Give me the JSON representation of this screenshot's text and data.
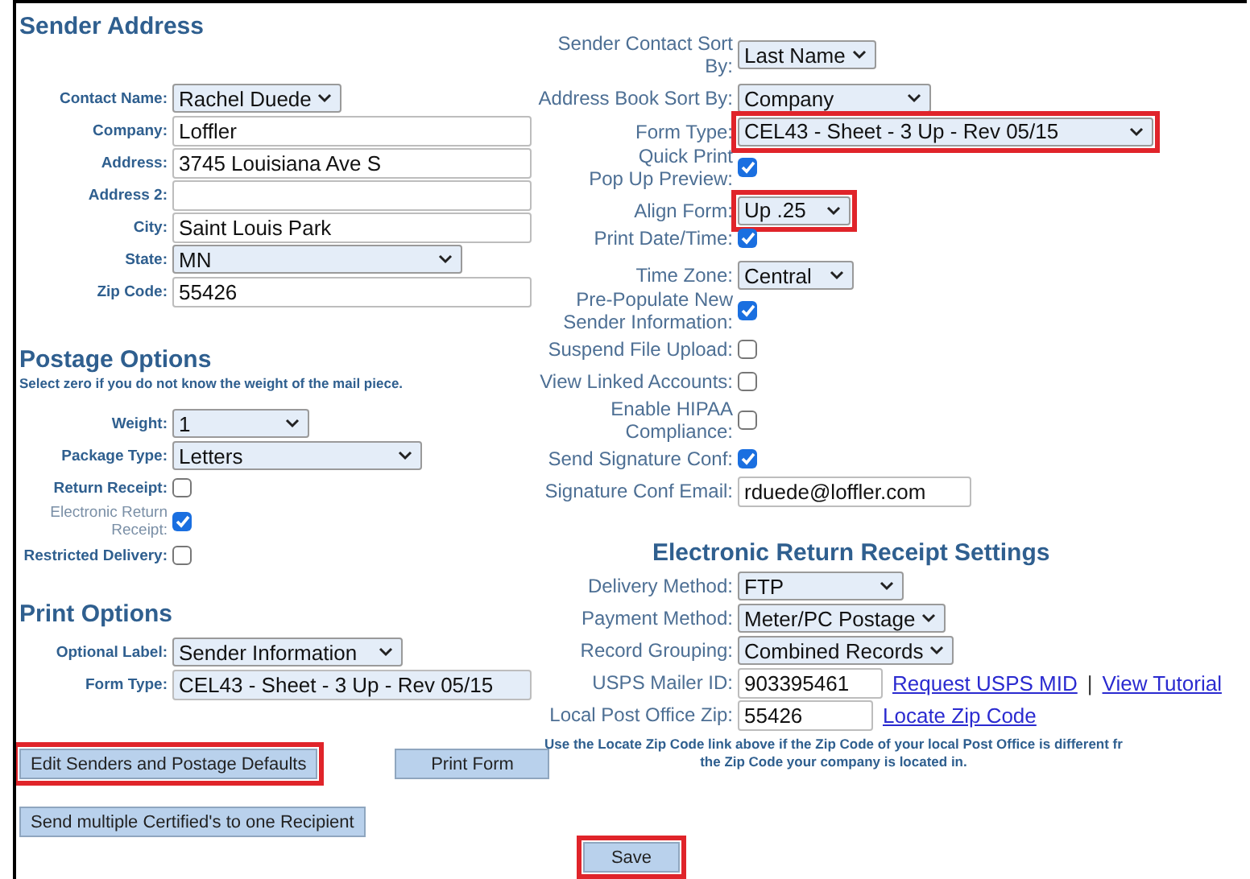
{
  "sender_address": {
    "title": "Sender Address",
    "fields": [
      {
        "label": [
          "Contact Name:"
        ],
        "kind": "select",
        "value": "Rachel Duede"
      },
      {
        "label": [
          "Company:"
        ],
        "kind": "text",
        "value": "Loffler"
      },
      {
        "label": [
          "Address:"
        ],
        "kind": "text",
        "value": "3745 Louisiana Ave S"
      },
      {
        "label": [
          "Address 2:"
        ],
        "kind": "text"
      },
      {
        "label": [
          "City:"
        ],
        "kind": "text",
        "value": "Saint Louis Park"
      },
      {
        "label": [
          "State:"
        ],
        "kind": "select",
        "value": "MN"
      },
      {
        "label": [
          "Zip Code:"
        ],
        "kind": "text",
        "value": "55426"
      }
    ]
  },
  "postage_options": {
    "title": "Postage Options",
    "hint": "Select zero if you do not know the weight of the mail piece.",
    "fields": [
      {
        "label": [
          "Weight:"
        ],
        "kind": "select",
        "value": "1"
      },
      {
        "label": [
          "Package Type:"
        ],
        "kind": "select",
        "value": "Letters"
      },
      {
        "label": [
          "Return Receipt:"
        ],
        "kind": "checkbox",
        "checked": false,
        "disabled": false
      },
      {
        "label": [
          "Electronic Return",
          "Receipt:"
        ],
        "kind": "checkbox",
        "checked": true,
        "disabled": true
      },
      {
        "label": [
          "Restricted Delivery:"
        ],
        "kind": "checkbox",
        "checked": false,
        "disabled": false
      }
    ]
  },
  "print_options": {
    "title": "Print Options",
    "fields": [
      {
        "label": [
          "Optional Label:"
        ],
        "kind": "select",
        "value": "Sender Information"
      },
      {
        "label": [
          "Form Type:"
        ],
        "kind": "readonly",
        "value": "CEL43 - Sheet - 3 Up - Rev 05/15"
      }
    ]
  },
  "buttons": [
    {
      "label": "Edit Senders and Postage Defaults",
      "highlighted": true
    },
    {
      "label": "Print Form",
      "highlighted": false
    },
    {
      "label": "Send multiple Certified's to one Recipient",
      "highlighted": false
    }
  ],
  "preferences": [
    {
      "label": [
        "Sender Contact Sort",
        "By:"
      ],
      "kind": "select",
      "value": "Last Name",
      "highlighted": false
    },
    {
      "label": [
        "Address Book Sort By:"
      ],
      "kind": "select",
      "value": "Company",
      "highlighted": false
    },
    {
      "label": [
        "Form Type:"
      ],
      "kind": "select",
      "value": "CEL43 - Sheet - 3 Up - Rev 05/15",
      "highlighted": true
    },
    {
      "label": [
        "Quick Print",
        "Pop Up Preview:"
      ],
      "kind": "checkbox",
      "checked": true
    },
    {
      "label": [
        "Align Form:"
      ],
      "kind": "select",
      "value": "Up .25",
      "highlighted": true
    },
    {
      "label": [
        "Print Date/Time:"
      ],
      "kind": "checkbox",
      "checked": true
    },
    {
      "label": [
        "Time Zone:"
      ],
      "kind": "select",
      "value": "Central",
      "highlighted": false
    },
    {
      "label": [
        "Pre-Populate New",
        "Sender Information:"
      ],
      "kind": "checkbox",
      "checked": true
    },
    {
      "label": [
        "Suspend File Upload:"
      ],
      "kind": "checkbox",
      "checked": false
    },
    {
      "label": [
        "View Linked Accounts:"
      ],
      "kind": "checkbox",
      "checked": false
    },
    {
      "label": [
        "Enable HIPAA",
        "Compliance:"
      ],
      "kind": "checkbox",
      "checked": false
    },
    {
      "label": [
        "Send Signature Conf:"
      ],
      "kind": "checkbox",
      "checked": true
    },
    {
      "label": [
        "Signature Conf Email:"
      ],
      "kind": "text",
      "value": "rduede@loffler.com"
    }
  ],
  "electronic_return_receipt": {
    "title": "Electronic Return Receipt Settings",
    "fields": [
      {
        "label": [
          "Delivery Method:"
        ],
        "kind": "select",
        "value": "FTP"
      },
      {
        "label": [
          "Payment Method:"
        ],
        "kind": "select",
        "value": "Meter/PC Postage"
      },
      {
        "label": [
          "Record Grouping:"
        ],
        "kind": "select",
        "value": "Combined Records"
      },
      {
        "label": [
          "USPS Mailer ID:"
        ],
        "kind": "text",
        "value": "903395461",
        "links": [
          "Request USPS MID",
          "View Tutorial"
        ],
        "separator": "|"
      },
      {
        "label": [
          "Local Post Office Zip:"
        ],
        "kind": "text",
        "value": "55426",
        "links": [
          "Locate Zip Code"
        ]
      }
    ],
    "note": [
      "Use the Locate Zip Code link above if the Zip Code of your local Post Office is different fr",
      "the Zip Code your company is located in."
    ]
  },
  "save_button": {
    "label": "Save",
    "highlighted": true
  }
}
